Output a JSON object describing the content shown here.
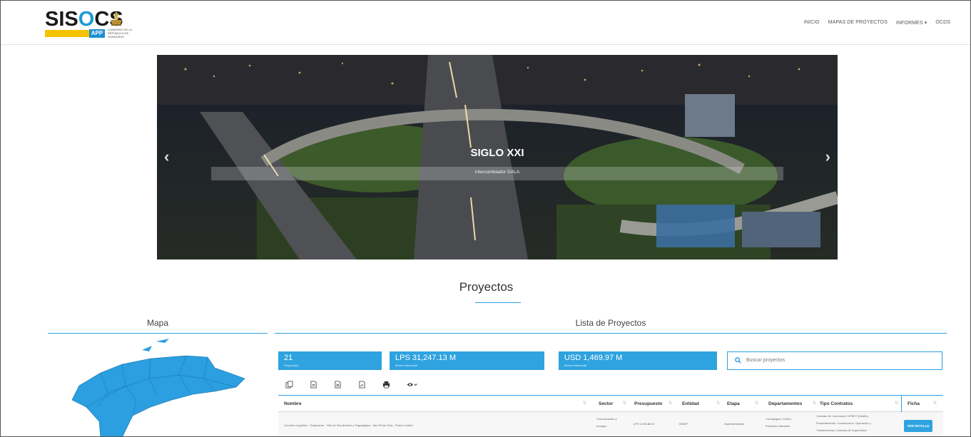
{
  "header": {
    "logo_main": "SISOCS",
    "logo_app": "APP",
    "logo_sub": "GOBIERNO DE LA REPÚBLICA DE HONDURAS",
    "nav": [
      "INICIO",
      "MAPAS DE PROYECTOS",
      "INFORMES ▾",
      "OCDS"
    ]
  },
  "carousel": {
    "title": "SIGLO XXI",
    "subtitle": "Intercambiador GALA",
    "prev_icon": "chevron-left-icon",
    "next_icon": "chevron-right-icon"
  },
  "section": {
    "title": "Proyectos"
  },
  "mapa": {
    "title": "Mapa",
    "fill_color": "#2b9fe0"
  },
  "lista": {
    "title": "Lista de Proyectos",
    "stats": [
      {
        "value": "21",
        "label": "Proyecto(s)"
      },
      {
        "value": "LPS 31,247.13 M",
        "label": "Monto referencial"
      },
      {
        "value": "USD 1,469.97 M",
        "label": "Monto referencial"
      }
    ],
    "search_placeholder": "Buscar proyectos",
    "toolbar_icons": [
      "copy-icon",
      "csv-icon",
      "excel-icon",
      "pdf-icon",
      "print-icon",
      "eye-icon"
    ],
    "columns": [
      "Nombre",
      "Sector",
      "Presupuesto",
      "Entidad",
      "Etapa",
      "Departamentos",
      "Tipo Contratos",
      "Ficha"
    ],
    "rows": [
      {
        "nombre": "Corredor Logístico - Goascorán - Villa de San Antonio y Tegucigalpa - San Pedro Sula - Puerto Cortés",
        "sector_1": "Comunicación y",
        "sector_2": "energía",
        "presupuesto": "LPS 1,936.88 M",
        "entidad": "INSEP",
        "etapa": "Implementación",
        "departamentos_1": "Comayagua, Cortés,",
        "departamentos_2": "Francisco Morazán",
        "tipo_1": "Contrato de Concesión / DFBOT (Diseño,",
        "tipo_2": "Financiamiento, Construcción, Operación y",
        "tipo_3": "Transferencia), Contrato de Supervisión",
        "ficha": "VER DETALLE"
      }
    ]
  },
  "colors": {
    "accent": "#2fa3e0",
    "logo_yellow": "#f5c200"
  }
}
